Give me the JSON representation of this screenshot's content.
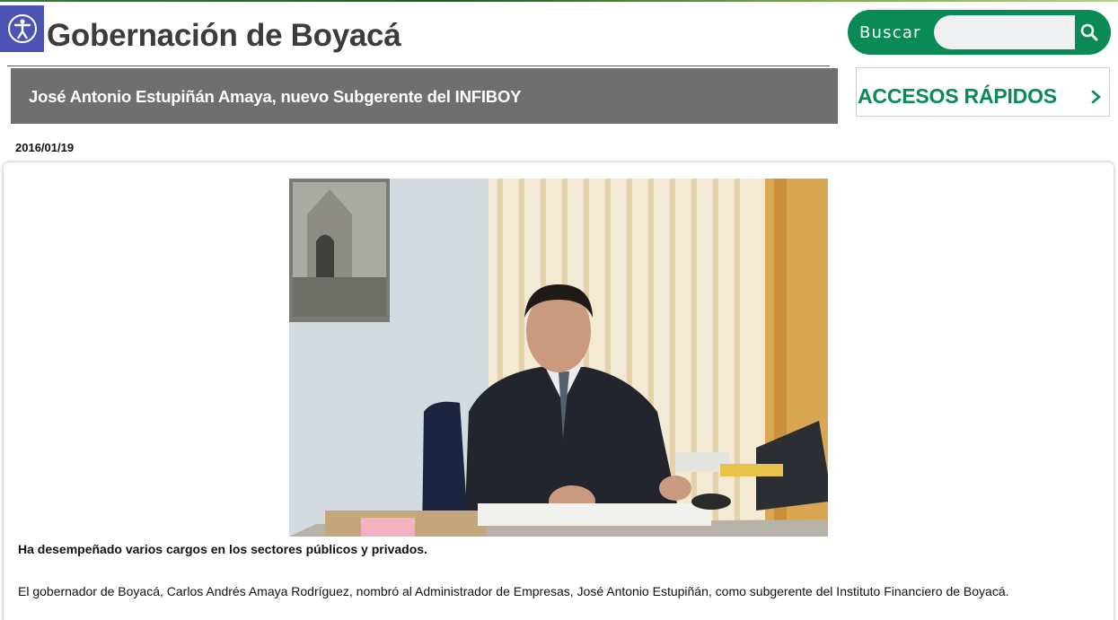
{
  "header": {
    "site_title": "Gobernación de Boyacá",
    "accessibility_icon": "accessibility-icon"
  },
  "search": {
    "label": "Buscar",
    "value": "",
    "placeholder": "",
    "button_icon": "search-icon"
  },
  "article": {
    "headline": "José Antonio Estupiñán Amaya, nuevo Subgerente del INFIBOY",
    "date": "2016/01/19",
    "lead": "Ha desempeñado varios cargos en los sectores públicos y privados.",
    "body": "El gobernador de Boyacá, Carlos Andrés Amaya Rodríguez, nombró al Administrador de Empresas, José Antonio Estupiñán, como subgerente del Instituto Financiero de Boyacá."
  },
  "sidebar": {
    "quick_access_label": "ACCESOS RÁPIDOS",
    "quick_access_icon": "chevron-right-icon"
  },
  "colors": {
    "brand_green": "#0a8a55",
    "headline_bar": "#6f6f6f",
    "accessibility_blue": "#4e54b5",
    "title_text": "#3c3c3c"
  }
}
